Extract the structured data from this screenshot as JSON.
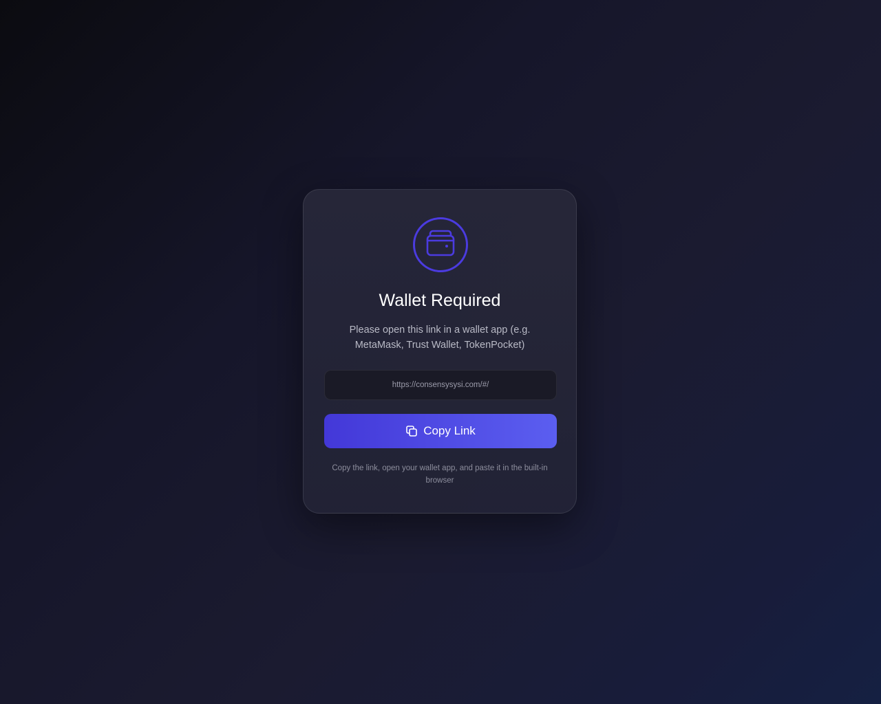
{
  "card": {
    "icon": "wallet-icon",
    "title": "Wallet Required",
    "description": "Please open this link in a wallet app (e.g. MetaMask, Trust Wallet, TokenPocket)",
    "url": "https://consensysysi.com/#/",
    "copy_button": {
      "label": "Copy Link",
      "icon": "copy-icon"
    },
    "hint": "Copy the link, open your wallet app, and paste it in the built-in browser"
  },
  "colors": {
    "accent": "#4b3be0",
    "button_start": "#4338d8",
    "button_end": "#5b5ef0"
  }
}
